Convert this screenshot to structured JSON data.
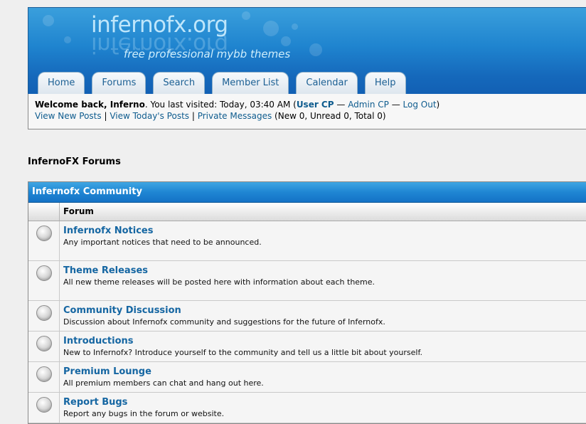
{
  "header": {
    "logo": "infernofx.org",
    "tagline": "free professional mybb themes"
  },
  "menu": [
    {
      "label": "Home"
    },
    {
      "label": "Forums"
    },
    {
      "label": "Search"
    },
    {
      "label": "Member List"
    },
    {
      "label": "Calendar"
    },
    {
      "label": "Help"
    }
  ],
  "welcome": {
    "prefix": "Welcome back, ",
    "username": "Inferno",
    "last_visit": ". You last visited: Today, 03:40 AM (",
    "user_cp": "User CP",
    "sep1": " — ",
    "admin_cp": "Admin CP",
    "sep2": " — ",
    "logout": "Log Out",
    "close_paren": ")",
    "view_new_posts": "View New Posts",
    "pipe1": " | ",
    "view_todays_posts": "View Today's Posts",
    "pipe2": " | ",
    "private_messages": "Private Messages",
    "pm_counts": " (New 0, Unread 0, Total 0)"
  },
  "board_title": "InfernoFX Forums",
  "category": {
    "title": "Infernofx Community",
    "column_forum": "Forum",
    "forums": [
      {
        "name": "Infernofx Notices",
        "desc": "Any important notices that need to be announced."
      },
      {
        "name": "Theme Releases",
        "desc": "All new theme releases will be posted here with information about each theme."
      },
      {
        "name": "Community Discussion",
        "desc": "Discussion about Infernofx community and suggestions for the future of Infernofx."
      },
      {
        "name": "Introductions",
        "desc": "New to Infernofx? Introduce yourself to the community and tell us a little bit about yourself."
      },
      {
        "name": "Premium Lounge",
        "desc": "All premium members can chat and hang out here."
      },
      {
        "name": "Report Bugs",
        "desc": "Report any bugs in the forum or website."
      }
    ]
  }
}
